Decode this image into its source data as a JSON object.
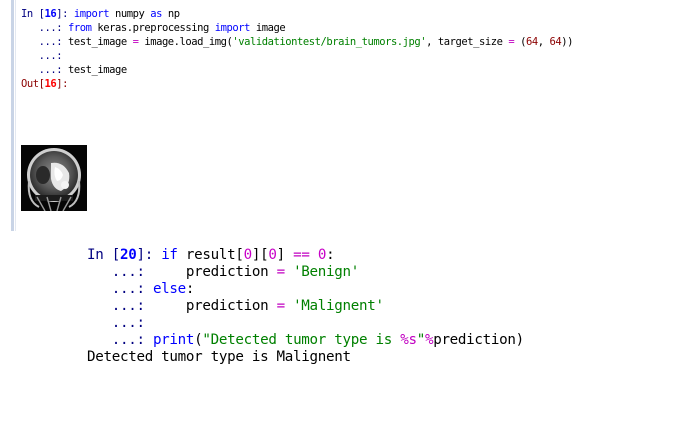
{
  "cell16": {
    "prompt_prefix": "In [",
    "prompt_number": "16",
    "prompt_suffix": "]: ",
    "continuation": "   ...: ",
    "line1": {
      "kw1": "import",
      "t1": " numpy ",
      "kw2": "as",
      "t2": " np"
    },
    "line2": {
      "kw1": "from",
      "t1": " keras.preprocessing ",
      "kw2": "import",
      "t2": " image"
    },
    "line3": {
      "t1": "test_image ",
      "op1": "=",
      "t2": " image.load_img(",
      "str1": "'validationtest/brain_tumors.jpg'",
      "t3": ", target_size ",
      "op2": "=",
      "t4": " (",
      "n1": "64",
      "t5": ", ",
      "n2": "64",
      "t6": "))"
    },
    "line5": {
      "t1": "test_image"
    },
    "out_prefix": "Out[",
    "out_number": "16",
    "out_suffix": "]:",
    "image_icon": "brain-mri-image"
  },
  "cell20": {
    "prompt_prefix": "In [",
    "prompt_number": "20",
    "prompt_suffix": "]: ",
    "continuation": "   ...: ",
    "line1": {
      "kw1": "if",
      "t1": " result[",
      "n1": "0",
      "t2": "][",
      "n2": "0",
      "t3": "] ",
      "op1": "==",
      "t4": " ",
      "n3": "0",
      "t5": ":"
    },
    "line2": {
      "t1": "    prediction ",
      "op1": "=",
      "t2": " ",
      "str1": "'Benign'"
    },
    "line3": {
      "kw1": "else",
      "t1": ":"
    },
    "line4": {
      "t1": "    prediction ",
      "op1": "=",
      "t2": " ",
      "str1": "'Malignent'"
    },
    "line6": {
      "kw1": "print",
      "t1": "(",
      "str1": "\"Detected tumor type is ",
      "str_fmt": "%s",
      "str2": "\"",
      "op1": "%",
      "t2": "prediction)"
    },
    "output": "Detected tumor type is Malignent"
  }
}
